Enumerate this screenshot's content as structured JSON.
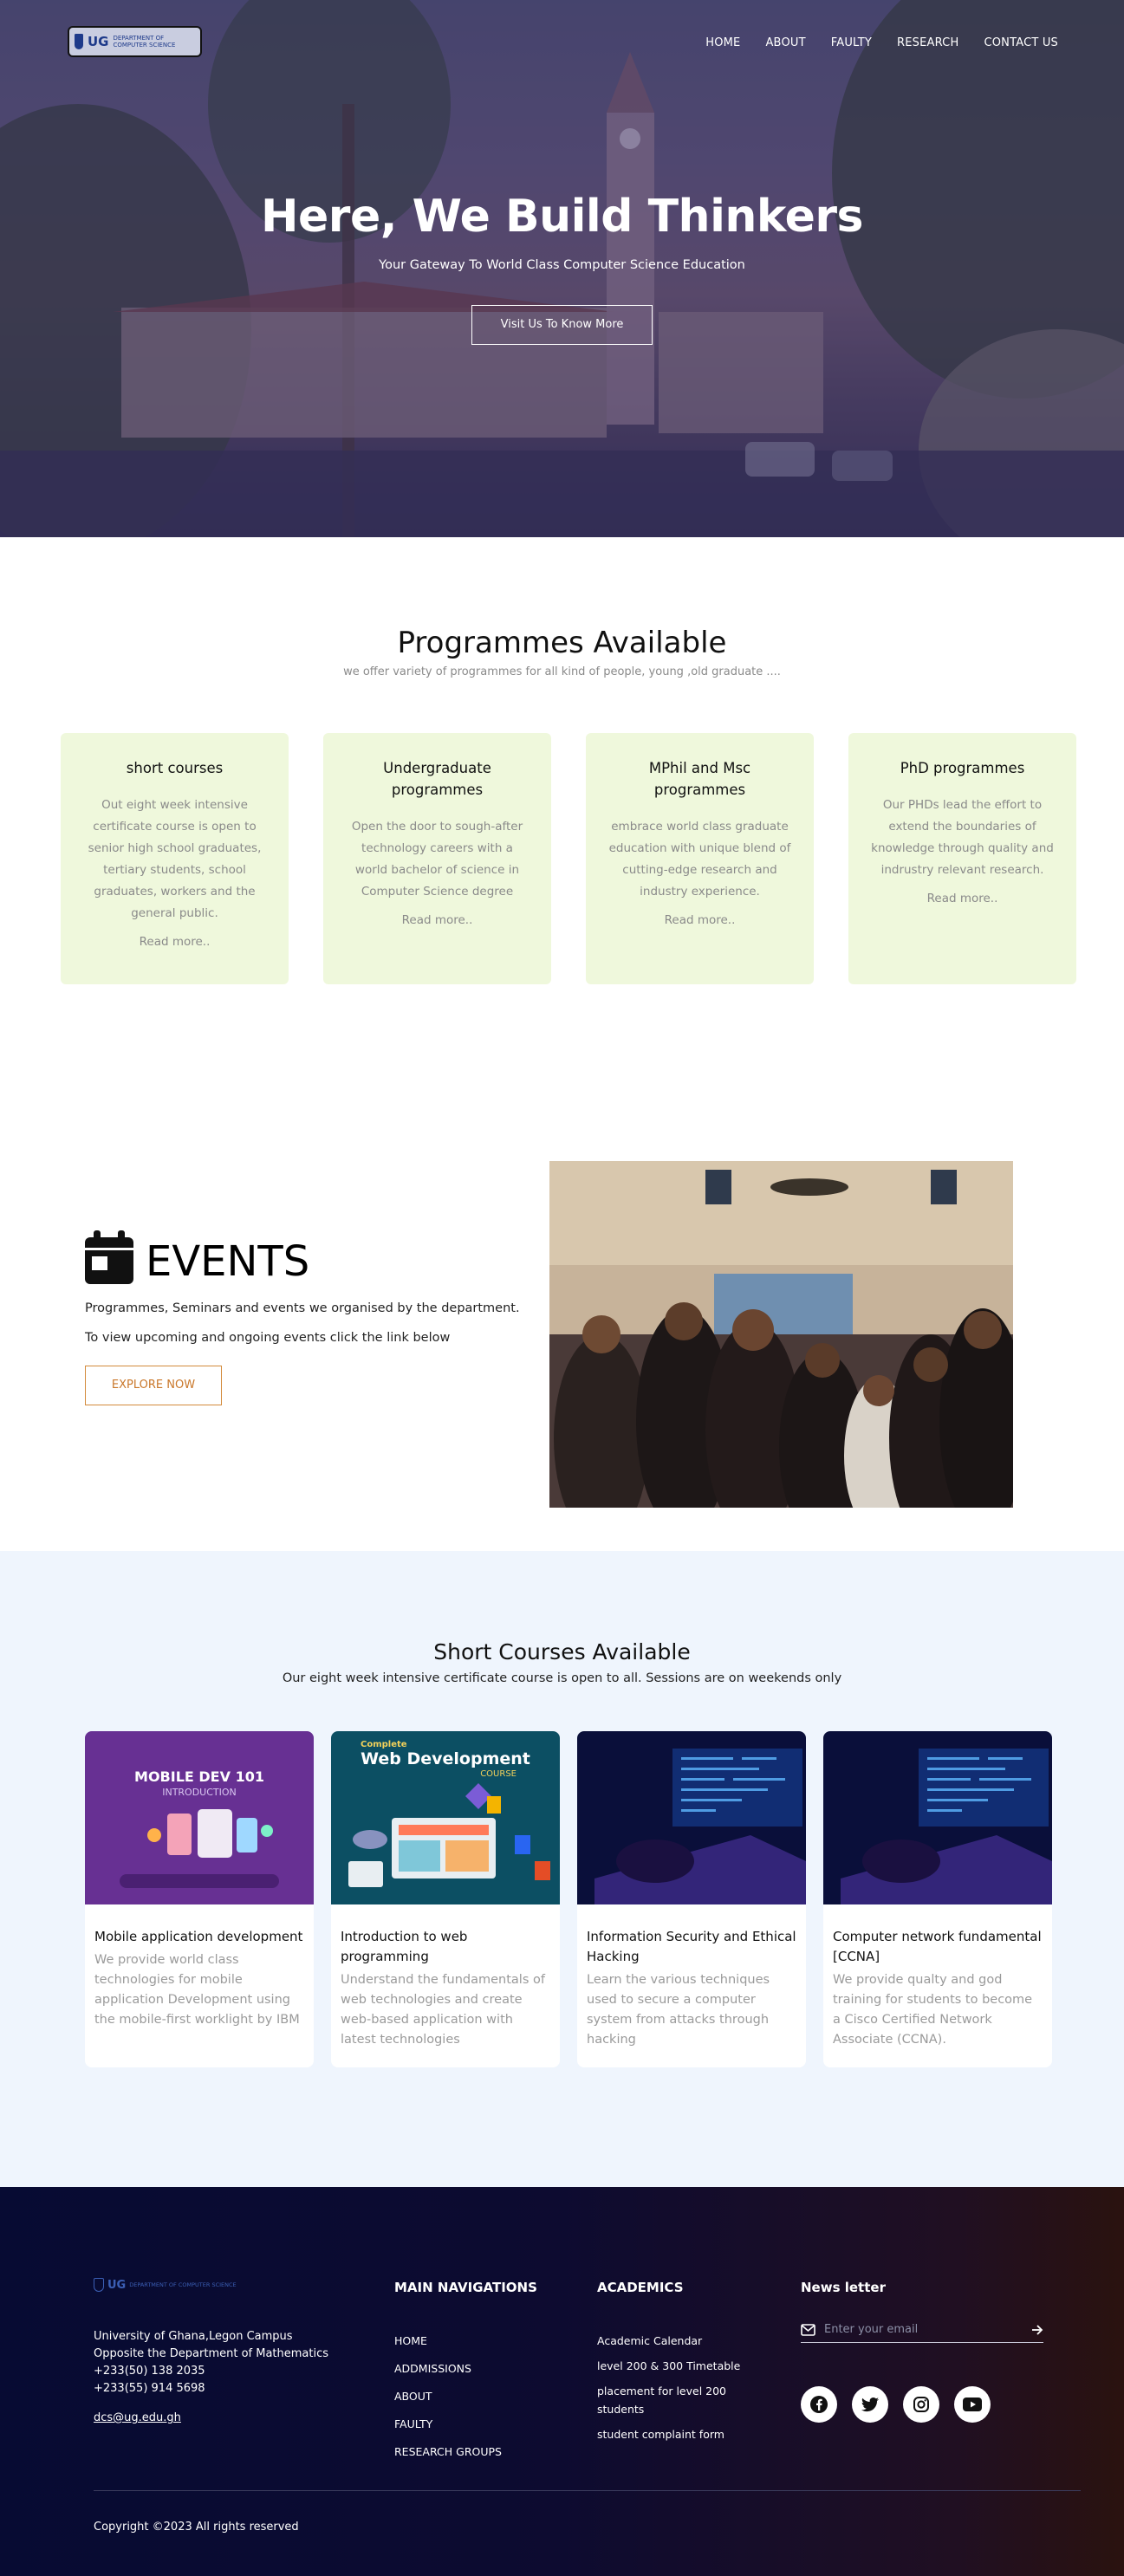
{
  "nav": {
    "logo_text": "UG",
    "logo_sub": "DEPARTMENT OF COMPUTER SCIENCE",
    "links": [
      "HOME",
      "ABOUT",
      "FAULTY",
      "RESEARCH",
      "CONTACT US"
    ]
  },
  "hero": {
    "title": "Here, We Build Thinkers",
    "subtitle": "Your Gateway To World Class Computer Science Education",
    "button": "Visit Us To Know More"
  },
  "programmes": {
    "title": "Programmes Available",
    "subtitle": "we offer variety of programmes for all kind of people, young ,old graduate ....",
    "cards": [
      {
        "title": "short courses",
        "text": "Out eight week intensive certificate course is open to senior high school graduates, tertiary students, school graduates, workers and the general public.",
        "link": "Read more.."
      },
      {
        "title": "Undergraduate programmes",
        "text": "Open the door to sough-after technology careers with a world bachelor of science in Computer Science degree",
        "link": "Read more.."
      },
      {
        "title": "MPhil and Msc programmes",
        "text": "embrace world class graduate education with unique blend of cutting-edge research and industry experience.",
        "link": "Read more.."
      },
      {
        "title": "PhD programmes",
        "text": "Our PHDs lead the effort to extend the boundaries of knowledge through quality and indrustry relevant research.",
        "link": "Read more.."
      }
    ]
  },
  "events": {
    "title": "EVENTS",
    "line1": "Programmes, Seminars and events we organised by the department.",
    "line2": "To view upcoming and ongoing events click the link below",
    "button": "EXPLORE NOW"
  },
  "courses": {
    "title": "Short Courses Available",
    "subtitle": "Our eight week intensive certificate course is open to all. Sessions are on weekends only",
    "cards": [
      {
        "title": "Mobile application development",
        "text": "We provide world class technologies for mobile application Development using the mobile-first worklight by IBM",
        "thumb_text": "MOBILE DEV 101",
        "thumb_sub": "INTRODUCTION"
      },
      {
        "title": "Introduction to web programming",
        "text": "Understand the fundamentals of web technologies and create web-based application with latest technologies",
        "thumb_top": "Complete",
        "thumb_text": "Web Development",
        "thumb_sub": "COURSE"
      },
      {
        "title": "Information Security and Ethical Hacking",
        "text": "Learn the various techniques used to secure a computer system from attacks through hacking"
      },
      {
        "title": "Computer network fundamental [CCNA]",
        "text": "We provide qualty and god training for students to become a Cisco Certified Network Associate (CCNA)."
      }
    ]
  },
  "footer": {
    "logo_text": "UG",
    "logo_sub": "DEPARTMENT OF COMPUTER SCIENCE",
    "address": [
      "University of Ghana,Legon Campus",
      "Opposite the Department of Mathematics",
      "+233(50) 138 2035",
      "+233(55) 914 5698"
    ],
    "email": "dcs@ug.edu.gh",
    "nav_title": "MAIN NAVIGATIONS",
    "nav_links": [
      "HOME",
      "ADDMISSIONS",
      "ABOUT",
      "FAULTY",
      "RESEARCH GROUPS"
    ],
    "academics_title": "ACADEMICS",
    "academics_links": [
      "Academic Calendar",
      "level 200 & 300 Timetable",
      "placement for level 200 students",
      "student complaint form"
    ],
    "newsletter_title": "News letter",
    "newsletter_placeholder": "Enter your email",
    "socials": [
      "facebook-icon",
      "twitter-icon",
      "instagram-icon",
      "youtube-icon"
    ],
    "copyright": "Copyright ©2023 All rights reserved"
  },
  "colors": {
    "program_card_bg": "#eff8dc",
    "courses_bg": "#eff5fd",
    "explore_accent": "#d38a3b",
    "footer_dark": "#070b33"
  }
}
